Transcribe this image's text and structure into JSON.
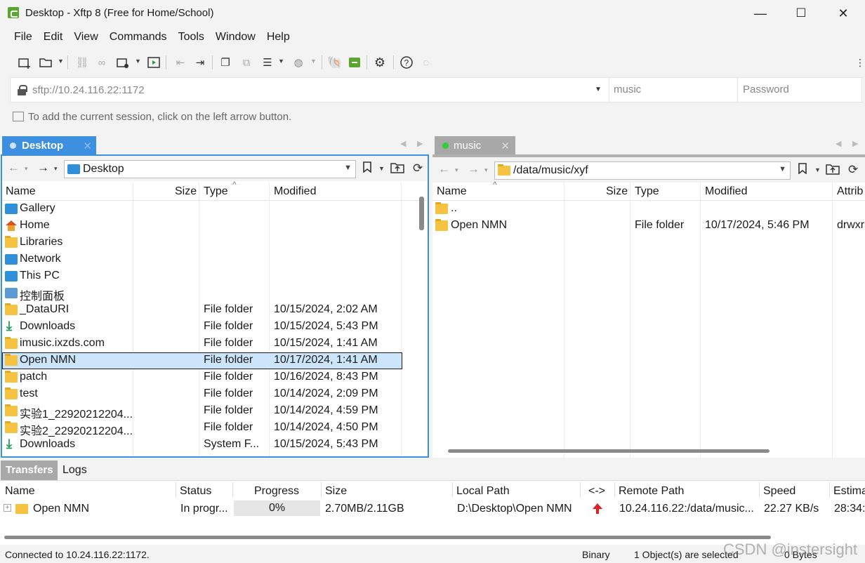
{
  "window": {
    "title": "Desktop - Xftp 8 (Free for Home/School)",
    "minimize": "—",
    "maximize": "☐",
    "close": "✕"
  },
  "menu": [
    "File",
    "Edit",
    "View",
    "Commands",
    "Tools",
    "Window",
    "Help"
  ],
  "address": {
    "url": "sftp://10.24.116.22:1172",
    "user_placeholder": "music",
    "password_placeholder": "Password",
    "hint": "To add the current session, click on the left arrow button."
  },
  "left_pane": {
    "tab": "Desktop",
    "path": "Desktop",
    "columns": [
      "Name",
      "Size",
      "Type",
      "Modified"
    ],
    "rows": [
      {
        "name": "Gallery",
        "type": "",
        "modified": "",
        "icon": "gallery-icon"
      },
      {
        "name": "Home",
        "type": "",
        "modified": "",
        "icon": "home-icon"
      },
      {
        "name": "Libraries",
        "type": "",
        "modified": "",
        "icon": "folder-icon"
      },
      {
        "name": "Network",
        "type": "",
        "modified": "",
        "icon": "network-icon"
      },
      {
        "name": "This PC",
        "type": "",
        "modified": "",
        "icon": "pc-icon"
      },
      {
        "name": "控制面板",
        "type": "",
        "modified": "",
        "icon": "control-panel-icon"
      },
      {
        "name": "_DataURI",
        "type": "File folder",
        "modified": "10/15/2024, 2:02 AM",
        "icon": "folder-icon"
      },
      {
        "name": "Downloads",
        "type": "File folder",
        "modified": "10/15/2024, 5:43 PM",
        "icon": "download-icon"
      },
      {
        "name": "imusic.ixzds.com",
        "type": "File folder",
        "modified": "10/15/2024, 1:41 AM",
        "icon": "folder-icon"
      },
      {
        "name": "Open NMN",
        "type": "File folder",
        "modified": "10/17/2024, 1:41 AM",
        "icon": "folder-icon"
      },
      {
        "name": "patch",
        "type": "File folder",
        "modified": "10/16/2024, 8:43 PM",
        "icon": "folder-icon"
      },
      {
        "name": "test",
        "type": "File folder",
        "modified": "10/14/2024, 2:09 PM",
        "icon": "folder-icon"
      },
      {
        "name": "实验1_22920212204...",
        "type": "File folder",
        "modified": "10/14/2024, 4:59 PM",
        "icon": "folder-icon"
      },
      {
        "name": "实验2_22920212204...",
        "type": "File folder",
        "modified": "10/14/2024, 4:50 PM",
        "icon": "folder-icon"
      },
      {
        "name": "Downloads",
        "type": "System F...",
        "modified": "10/15/2024, 5:43 PM",
        "icon": "download-icon"
      }
    ]
  },
  "right_pane": {
    "tab": "music",
    "path": "/data/music/xyf",
    "columns": [
      "Name",
      "Size",
      "Type",
      "Modified",
      "Attrib"
    ],
    "rows": [
      {
        "name": "..",
        "type": "",
        "modified": "",
        "attrib": ""
      },
      {
        "name": "Open NMN",
        "type": "File folder",
        "modified": "10/17/2024, 5:46 PM",
        "attrib": "drwxr"
      }
    ]
  },
  "transfers": {
    "tab": "Transfers",
    "logs_tab": "Logs",
    "columns": [
      "Name",
      "Status",
      "Progress",
      "Size",
      "Local Path",
      "<->",
      "Remote Path",
      "Speed",
      "Estima"
    ],
    "row": {
      "expand": "+",
      "name": "Open NMN",
      "status": "In progr...",
      "progress": "0%",
      "size": "2.70MB/2.11GB",
      "local": "D:\\Desktop\\Open NMN",
      "remote": "10.24.116.22:/data/music...",
      "speed": "22.27 KB/s",
      "estimate": "28:34:"
    }
  },
  "status": {
    "connection": "Connected to 10.24.116.22:1172.",
    "mode": "Binary",
    "selection": "1 Object(s) are selected",
    "bytes": "0 Bytes"
  },
  "watermark": "CSDN @instersight",
  "colors": {
    "accent": "#3d8fe0",
    "selection": "#cce5fb",
    "folder": "#f5c242"
  }
}
